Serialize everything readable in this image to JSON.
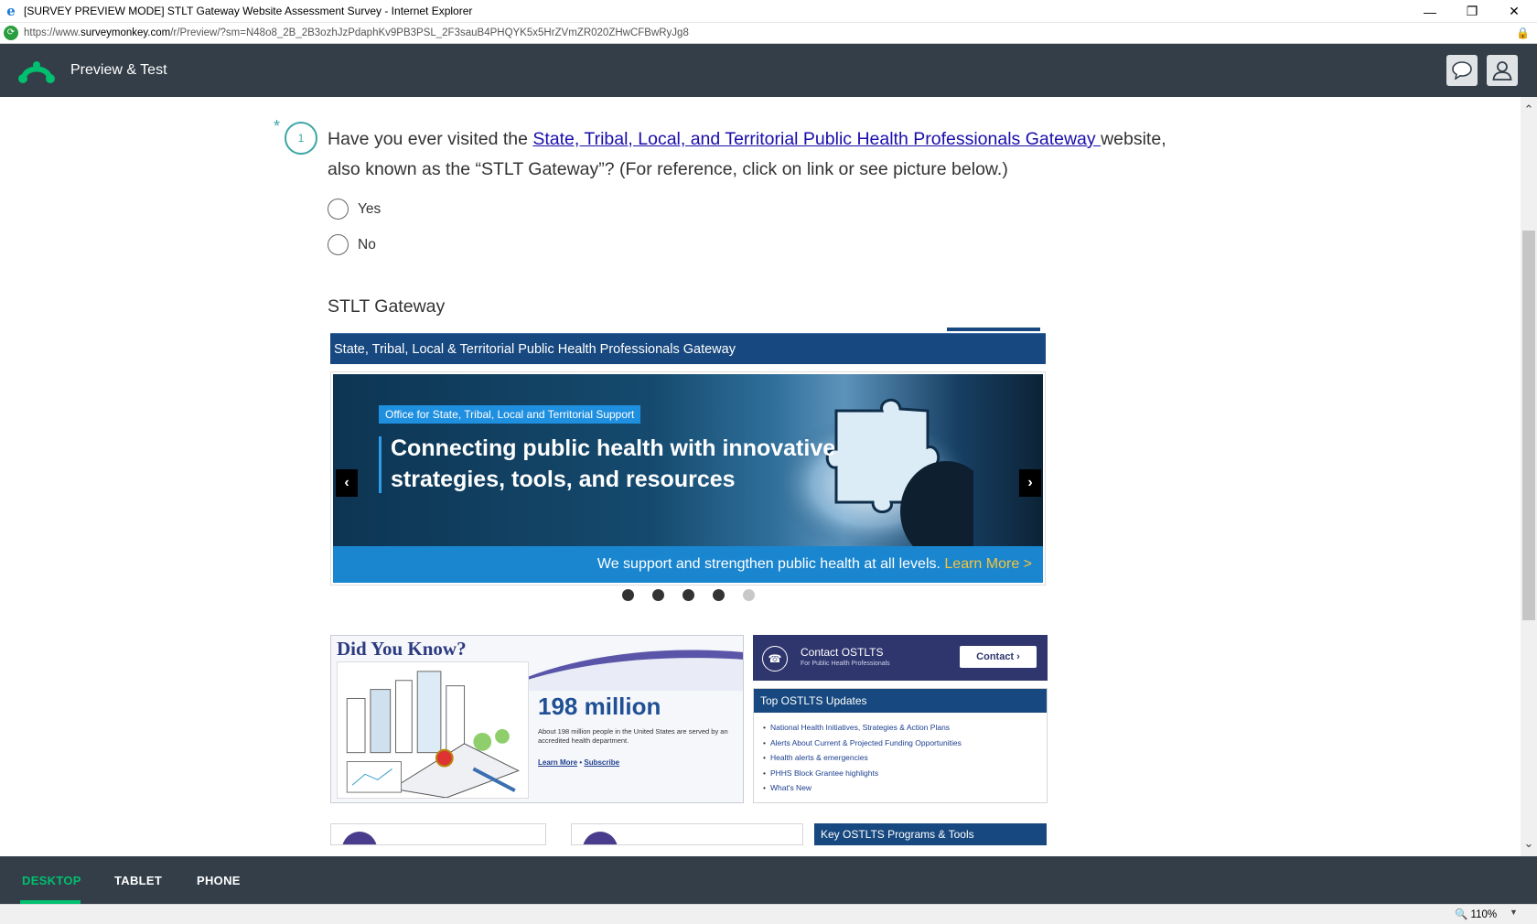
{
  "window": {
    "title": "[SURVEY PREVIEW MODE] STLT Gateway Website Assessment Survey - Internet Explorer",
    "url_prefix": "https://www.",
    "url_domain": "surveymonkey.com",
    "url_path": "/r/Preview/?sm=N48o8_2B_2B3ozhJzPdaphKv9PB3PSL_2F3sauB4PHQYK5x5HrZVmZR020ZHwCFBwRyJg8",
    "controls": {
      "minimize": "—",
      "restore": "❐",
      "close": "✕"
    }
  },
  "header": {
    "title": "Preview & Test",
    "icons": [
      "surveymonkey-logo",
      "chat-icon",
      "user-icon"
    ]
  },
  "question": {
    "required_mark": "*",
    "number": "1",
    "text_before": "Have you ever visited the ",
    "link_text": "State, Tribal, Local, and Territorial Public Health Professionals Gateway ",
    "text_after": "website, also known as the “STLT Gateway”? (For reference, click on link or see picture below.)",
    "options": [
      {
        "label": "Yes"
      },
      {
        "label": "No"
      }
    ]
  },
  "image": {
    "title": "STLT Gateway",
    "banner": "State, Tribal, Local & Territorial Public Health Professionals Gateway",
    "hero_tag": "Office for State, Tribal, Local and Territorial Support",
    "hero_headline_1": "Connecting public health with innovative",
    "hero_headline_2": "strategies, tools, and resources",
    "hero_footer": "We support and strengthen public health at all levels. ",
    "hero_footer_link": "Learn More >",
    "prev_arrow": "‹",
    "next_arrow": "›",
    "dyk_heading": "Did You Know?",
    "dyk_number": "198 million",
    "dyk_desc": "About 198 million people in the United States are served by an accredited health department.",
    "dyk_link1": "Learn More",
    "dyk_sep": " • ",
    "dyk_link2": "Subscribe",
    "contact_title": "Contact OSTLTS",
    "contact_sub": "For Public Health Professionals",
    "contact_button": "Contact ›",
    "updates_title": "Top OSTLTS Updates",
    "updates": [
      "National Health Initiatives, Strategies & Action Plans",
      "Alerts About Current & Projected Funding Opportunities",
      "Health alerts & emergencies",
      "PHHS Block Grantee highlights",
      "What's New"
    ],
    "key_programs": "Key OSTLTS Programs & Tools"
  },
  "devices": {
    "tabs": [
      "DESKTOP",
      "TABLET",
      "PHONE"
    ],
    "active": "DESKTOP"
  },
  "status": {
    "zoom": "110%"
  },
  "colors": {
    "header_bg": "#333e48",
    "accent_green": "#00bf6f",
    "question_teal": "#3aa6a4",
    "gateway_blue": "#17487f"
  }
}
